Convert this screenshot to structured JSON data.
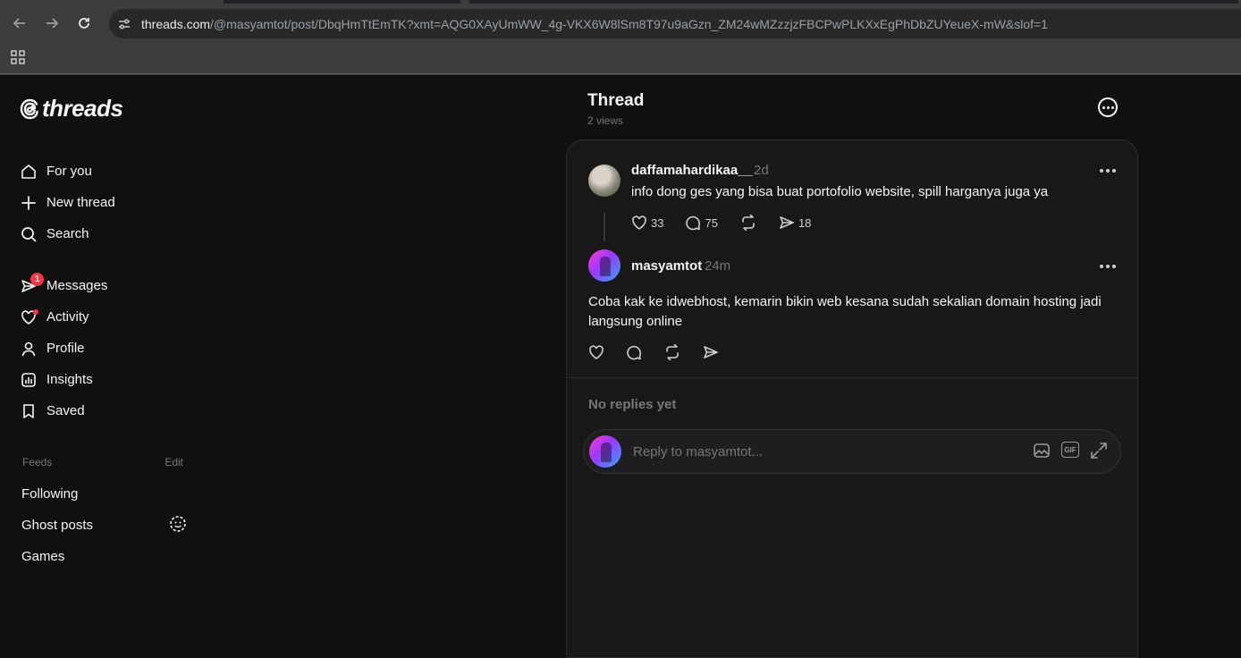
{
  "browser": {
    "url_host": "threads.com",
    "url_path": "/@masyamtot/post/DbqHmTtEmTK?xmt=AQG0XAyUmWW_4g-VKX6W8lSm8T97u9aGzn_ZM24wMZzzjzFBCPwPLKXxEgPhDbZUYeueX-mW&slof=1"
  },
  "logo": {
    "text": "threads"
  },
  "nav": {
    "for_you": "For you",
    "new_thread": "New thread",
    "search": "Search",
    "messages": "Messages",
    "messages_badge": "1",
    "activity": "Activity",
    "profile": "Profile",
    "insights": "Insights",
    "saved": "Saved"
  },
  "feeds": {
    "heading": "Feeds",
    "edit": "Edit",
    "items": [
      "Following",
      "Ghost posts",
      "Games"
    ]
  },
  "thread": {
    "title": "Thread",
    "views": "2 views"
  },
  "post": {
    "username": "daffamahardikaa__",
    "time": "2d",
    "text": "info dong ges yang bisa buat portofolio website, spill harganya juga ya",
    "likes": "33",
    "comments": "75",
    "shares": "18"
  },
  "reply": {
    "username": "masyamtot",
    "time": "24m",
    "text": "Coba kak ke idwebhost, kemarin bikin web kesana sudah sekalian domain hosting jadi langsung online"
  },
  "replies": {
    "empty_text": "No replies yet",
    "placeholder": "Reply to masyamtot...",
    "gif_label": "GIF"
  }
}
